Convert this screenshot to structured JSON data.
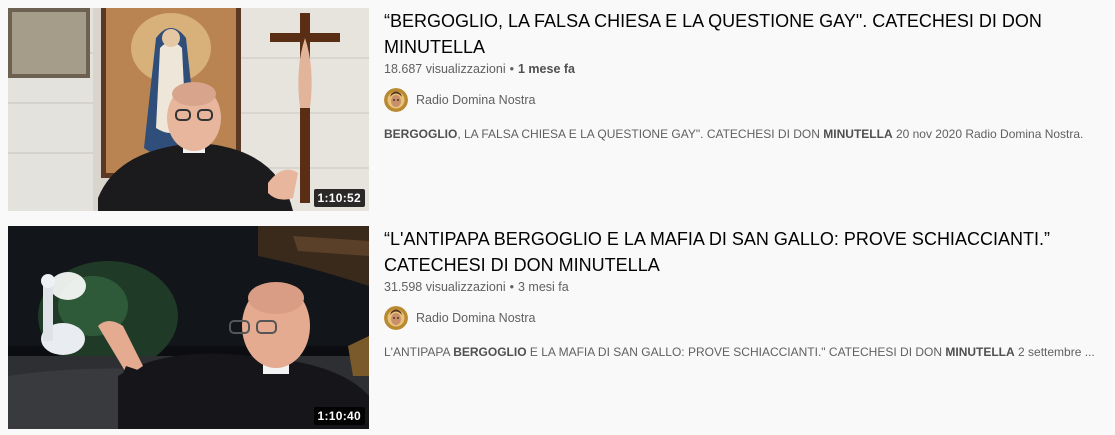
{
  "results": [
    {
      "title": "“BERGOGLIO, LA FALSA CHIESA E LA QUESTIONE GAY\". CATECHESI DI DON MINUTELLA",
      "views": "18.687 visualizzazioni",
      "date": "1 mese fa",
      "duration": "1:10:52",
      "channel": "Radio Domina Nostra",
      "snippet": [
        {
          "t": "BERGOGLIO",
          "b": true
        },
        {
          "t": ", LA FALSA CHIESA E LA QUESTIONE GAY\". CATECHESI DI DON ",
          "b": false
        },
        {
          "t": "MINUTELLA",
          "b": true
        },
        {
          "t": " 20 nov 2020 Radio Domina Nostra.",
          "b": false
        }
      ],
      "thumbnail_icon": "video-thumbnail-priest-madonna-crucifix"
    },
    {
      "title": "“L'ANTIPAPA BERGOGLIO E LA MAFIA DI SAN GALLO: PROVE SCHIACCIANTI.” CATECHESI DI DON MINUTELLA",
      "views": "31.598 visualizzazioni",
      "date": "3 mesi fa",
      "duration": "1:10:40",
      "channel": "Radio Domina Nostra",
      "snippet": [
        {
          "t": "L'ANTIPAPA ",
          "b": false
        },
        {
          "t": "BERGOGLIO",
          "b": true
        },
        {
          "t": " E LA MAFIA DI SAN GALLO: PROVE SCHIACCIANTI.\" CATECHESI DI DON ",
          "b": false
        },
        {
          "t": "MINUTELLA",
          "b": true
        },
        {
          "t": " 2 settembre ...",
          "b": false
        }
      ],
      "thumbnail_icon": "video-thumbnail-priest-night-statue"
    }
  ],
  "colors": {
    "background": "#f9f9f9",
    "title": "#030303",
    "secondary_text": "#606060",
    "duration_badge": "#000000"
  }
}
